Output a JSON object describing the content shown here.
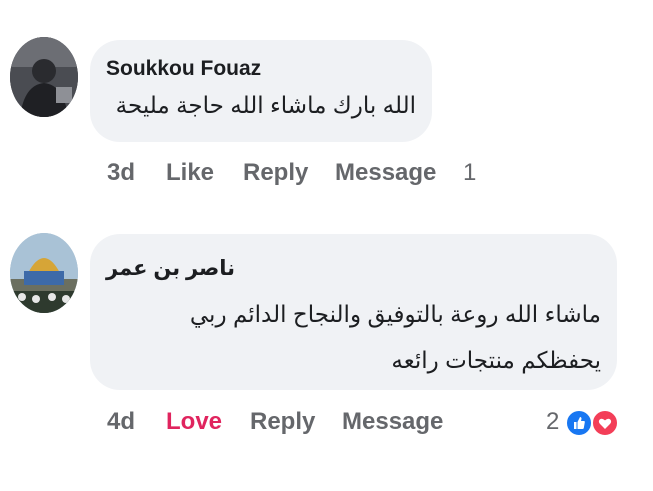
{
  "comments": [
    {
      "author": "Soukkou Fouaz",
      "lines": [
        "الله بارك ماشاء الله حاجة مليحة"
      ],
      "time": "3d",
      "reaction_label": "Like",
      "reply_label": "Reply",
      "message_label": "Message",
      "reaction_count": "1"
    },
    {
      "author": "ناصر بن عمر",
      "lines": [
        "ماشاء الله روعة بالتوفيق والنجاح الدائم ربي",
        "يحفظكم منتجات رائعه"
      ],
      "time": "4d",
      "reaction_label": "Love",
      "reply_label": "Reply",
      "message_label": "Message",
      "reaction_count": "2",
      "reaction_icons": [
        "like-icon",
        "love-icon"
      ]
    }
  ],
  "colors": {
    "bubble": "#f0f2f5",
    "meta_text": "#65676b",
    "love": "#e0245e",
    "like_blue": "#1877f2",
    "love_red": "#f33e58"
  }
}
